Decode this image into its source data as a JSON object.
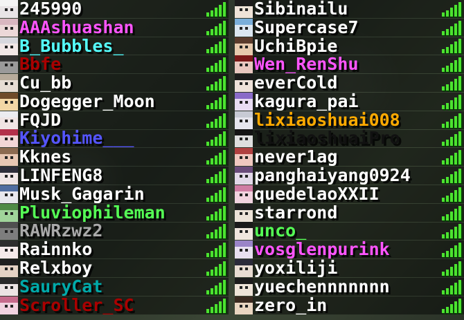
{
  "tab_list": {
    "left": [
      {
        "name": "245990",
        "color": "#ffffff",
        "skin": "#e8e4e6",
        "hair": "#f4f4f4"
      },
      {
        "name": "AAAshuashan",
        "color": "#ff55ff",
        "skin": "#ecd8d8",
        "hair": "#d9b7c0"
      },
      {
        "name": "B_Bubbles_",
        "color": "#55ffff",
        "skin": "#f2e7e7",
        "hair": "#d8d8de"
      },
      {
        "name": "Bbfe",
        "color": "#aa0000",
        "skin": "#9a9a9a",
        "hair": "#303030"
      },
      {
        "name": "Cu_bb",
        "color": "#ffffff",
        "skin": "#e6dcd4",
        "hair": "#b7ab9b"
      },
      {
        "name": "Dogegger_Moon",
        "color": "#ffffff",
        "skin": "#f3d7a5",
        "hair": "#6f4b2a"
      },
      {
        "name": "FQJD",
        "color": "#ffffff",
        "skin": "#f0e4e4",
        "hair": "#ececf0"
      },
      {
        "name": "Kiyohime___",
        "color": "#5555ff",
        "skin": "#f2d6d6",
        "hair": "#b3304a"
      },
      {
        "name": "Kknes",
        "color": "#ffffff",
        "skin": "#e8c7b3",
        "hair": "#8c6a50"
      },
      {
        "name": "LINFENG8",
        "color": "#ffffff",
        "skin": "#efe5e5",
        "hair": "#2e2e3a"
      },
      {
        "name": "Musk_Gagarin",
        "color": "#ffffff",
        "skin": "#e8e8ee",
        "hair": "#4f6da0"
      },
      {
        "name": "Pluviophileman",
        "color": "#55ff55",
        "skin": "#a0d49a",
        "hair": "#4f8a46"
      },
      {
        "name": "RAWRzwz2",
        "color": "#aaaaaa",
        "skin": "#7d7d7d",
        "hair": "#4f4f4f"
      },
      {
        "name": "Rainnko",
        "color": "#ffffff",
        "skin": "#f5eaea",
        "hair": "#2d2d2d"
      },
      {
        "name": "Relxboy",
        "color": "#ffffff",
        "skin": "#e4d2c4",
        "hair": "#1e1e1e"
      },
      {
        "name": "SauryCat",
        "color": "#00aaaa",
        "skin": "#ece4e4",
        "hair": "#2a2a2a"
      },
      {
        "name": "Scroller_SC",
        "color": "#aa0000",
        "skin": "#f1d3e0",
        "hair": "#c66b8c"
      }
    ],
    "right": [
      {
        "name": "Sibinailu",
        "color": "#ffffff",
        "skin": "#efe3d8",
        "hair": "#1c1c1c"
      },
      {
        "name": "Supercase7",
        "color": "#ffffff",
        "skin": "#dbe6f0",
        "hair": "#7aaed9"
      },
      {
        "name": "UchiBpie",
        "color": "#ffffff",
        "skin": "#e6c9ad",
        "hair": "#5a3b2c"
      },
      {
        "name": "Wen_RenShu",
        "color": "#ff55ff",
        "skin": "#e9c7c0",
        "hair": "#7a1818"
      },
      {
        "name": "everCold",
        "color": "#ffffff",
        "skin": "#eee2da",
        "hair": "#1b1b1b"
      },
      {
        "name": "kagura_pai",
        "color": "#ffffff",
        "skin": "#e8dcf2",
        "hair": "#8a6bc8"
      },
      {
        "name": "lixiaoshuai008",
        "color": "#ffaa00",
        "skin": "#e6e6ee",
        "hair": "#c7cad4"
      },
      {
        "name": "lixiaoshuaiPro",
        "color": "#111111",
        "skin": "#dedede",
        "hair": "#141414"
      },
      {
        "name": "never1ag",
        "color": "#ffffff",
        "skin": "#f0c8c0",
        "hair": "#b04040"
      },
      {
        "name": "panghaiyang0924",
        "color": "#ffffff",
        "skin": "#e2d8e8",
        "hair": "#6a4b7a"
      },
      {
        "name": "quedelaoXXII",
        "color": "#ffffff",
        "skin": "#f1d3df",
        "hair": "#d07ca3"
      },
      {
        "name": "starrond",
        "color": "#ffffff",
        "skin": "#ece3d8",
        "hair": "#202020"
      },
      {
        "name": "unco_",
        "color": "#55ff55",
        "skin": "#f0e6de",
        "hair": "#1a1a1a"
      },
      {
        "name": "vosglenpurink",
        "color": "#ff55ff",
        "skin": "#e8e0f0",
        "hair": "#9a84c8"
      },
      {
        "name": "yoxiliji",
        "color": "#ffffff",
        "skin": "#e8dcd2",
        "hair": "#2b2b3a"
      },
      {
        "name": "yuechennnnnnn",
        "color": "#ffffff",
        "skin": "#eee4d8",
        "hair": "#1c1c1c"
      },
      {
        "name": "zero_in",
        "color": "#ffffff",
        "skin": "#e9d5c0",
        "hair": "#3a2a20"
      }
    ]
  },
  "ping_icon": "ping-bars-full-green"
}
